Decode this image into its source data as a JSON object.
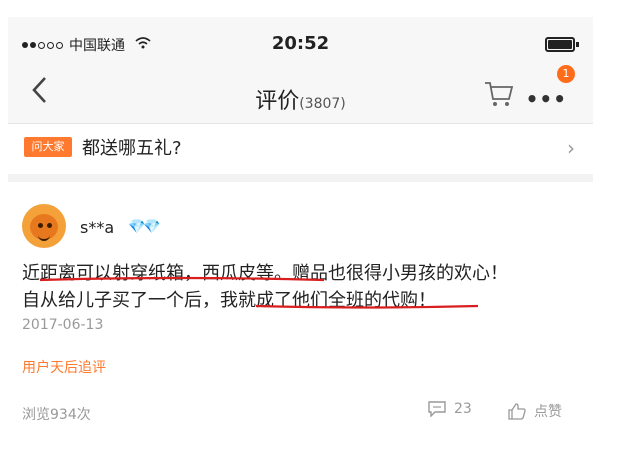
{
  "status": {
    "carrier": "中国联通",
    "time": "20:52"
  },
  "nav": {
    "back": "<",
    "title": "评价",
    "count": "(3807)",
    "badge": "1",
    "more": "•••"
  },
  "question": {
    "tag": "问大家",
    "text": "都送哪五礼?",
    "arrow": "›"
  },
  "review": {
    "username": "s**a",
    "gems": "💎💎",
    "line1": "近距离可以射穿纸箱，西瓜皮等。赠品也很得小男孩的欢心！",
    "line2": "自从给儿子买了一个后，我就成了他们全班的代购！",
    "date": "2017-06-13",
    "follow": "用户天后追评",
    "views": "浏览934次",
    "comments": "23",
    "like": "点赞"
  },
  "colors": {
    "accent": "#ff7a2f",
    "underline": "#d81e1e"
  }
}
